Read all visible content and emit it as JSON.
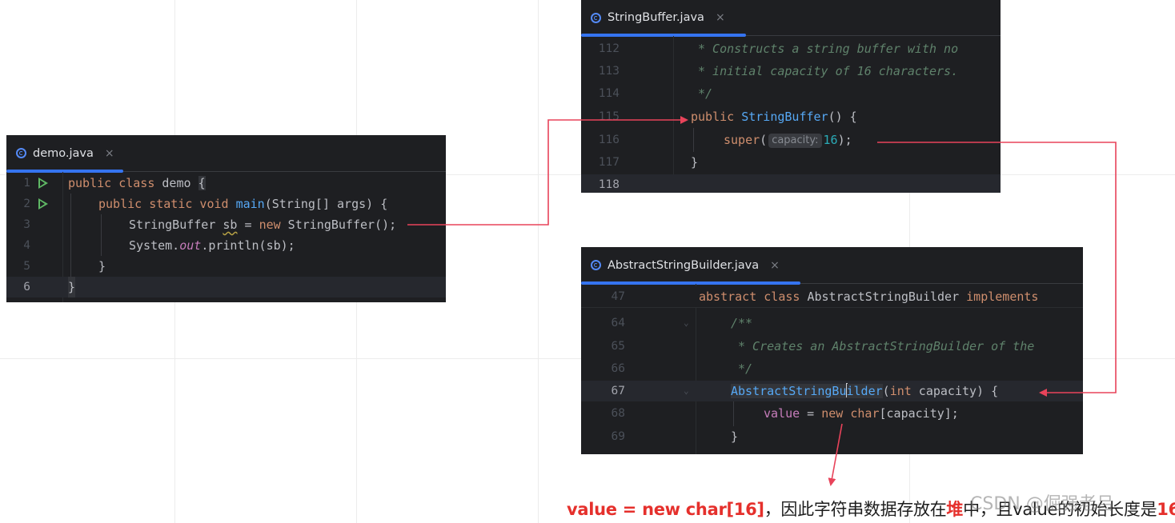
{
  "demo_editor": {
    "tab": {
      "filename": "demo.java",
      "close": "×"
    },
    "lines": [
      {
        "n": "1",
        "run": true
      },
      {
        "n": "2",
        "run": true
      },
      {
        "n": "3"
      },
      {
        "n": "4"
      },
      {
        "n": "5"
      },
      {
        "n": "6",
        "current": true
      }
    ],
    "code": {
      "l1_kw": "public class",
      "l1_name": " demo ",
      "l1_brace": "{",
      "l2_kw": "public static void",
      "l2_fn": "main",
      "l2_rest": "(String[] args) {",
      "l3_type": "StringBuffer ",
      "l3_var": "sb",
      "l3_eq": " = ",
      "l3_new": "new",
      "l3_rest": " StringBuffer();",
      "l4_a": "System.",
      "l4_out": "out",
      "l4_b": ".println(sb);",
      "l5": "}",
      "l6": "}"
    }
  },
  "stringbuffer_editor": {
    "tab": {
      "filename": "StringBuffer.java",
      "close": "×"
    },
    "lines": [
      "112",
      "113",
      "114",
      "115",
      "116",
      "117",
      "118"
    ],
    "code": {
      "l112": "* Constructs a string buffer with no",
      "l113": "* initial capacity of 16 characters.",
      "l114": "*/",
      "l115_kw": "public",
      "l115_fn": "StringBuffer",
      "l115_rest": "() {",
      "l116_kw": "super",
      "l116_open": "(",
      "l116_hint": "capacity:",
      "l116_num": "16",
      "l116_close": ");",
      "l117": "}"
    }
  },
  "asb_editor": {
    "tab": {
      "filename": "AbstractStringBuilder.java",
      "close": "×"
    },
    "lines": [
      "47",
      "64",
      "65",
      "66",
      "67",
      "68",
      "69"
    ],
    "code": {
      "l47_kw": "abstract class",
      "l47_name": " AbstractStringBuilder ",
      "l47_impl": "implements",
      "l64": "/**",
      "l65": "* Creates an AbstractStringBuilder of the",
      "l66": "*/",
      "l67_a": "AbstractStringBu",
      "l67_b": "ilder",
      "l67_kw": "int",
      "l67_rest": " capacity) {",
      "l68_fld": "value",
      "l68_eq": " = ",
      "l68_new": "new",
      "l68_char": " char",
      "l68_rest": "[capacity];",
      "l69": "}"
    }
  },
  "caption": {
    "part1": "value = new char[16]",
    "part2": "，因此字符串数据存放在",
    "part3": "堆",
    "part4": "中，且value的初始长度是",
    "part5": "16"
  },
  "watermark": "CSDN @倔强老吕",
  "colors": {
    "arrow": "#e8435a",
    "editor_bg": "#1e1f22",
    "accent": "#3574f0",
    "caption_red": "#e5302c"
  }
}
